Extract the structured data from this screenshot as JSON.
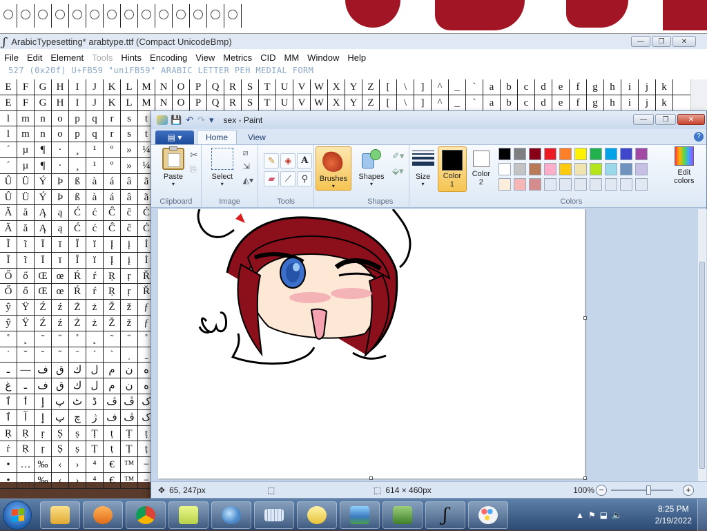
{
  "fontforge": {
    "title": "ArabicTypesetting*  arabtype.ttf (Compact UnicodeBmp)",
    "menu": [
      "File",
      "Edit",
      "Element",
      "Tools",
      "Hints",
      "Encoding",
      "View",
      "Metrics",
      "CID",
      "MM",
      "Window",
      "Help"
    ],
    "info_line": "527 (0x20f) U+FB59 \"uniFB59\" ARABIC LETTER PEH MEDIAL FORM",
    "glyph_rows": [
      [
        "E",
        "F",
        "G",
        "H",
        "I",
        "J",
        "K",
        "L",
        "M",
        "N",
        "O",
        "P",
        "Q",
        "R",
        "S",
        "T",
        "U",
        "V",
        "W",
        "X",
        "Y",
        "Z",
        "[",
        "\\",
        "]",
        "^",
        "_",
        "`",
        "a",
        "b",
        "c",
        "d",
        "e",
        "f",
        "g",
        "h",
        "i",
        "j",
        "k"
      ],
      [
        "E",
        "F",
        "G",
        "H",
        "I",
        "J",
        "K",
        "L",
        "M",
        "N",
        "O",
        "P",
        "Q",
        "R",
        "S",
        "T",
        "U",
        "V",
        "W",
        "X",
        "Y",
        "Z",
        "[",
        "\\",
        "]",
        "^",
        "_",
        "`",
        "a",
        "b",
        "c",
        "d",
        "e",
        "f",
        "g",
        "h",
        "i",
        "j",
        "k"
      ],
      [
        "l",
        "m",
        "n",
        "o",
        "p",
        "q",
        "r",
        "s",
        "t"
      ],
      [
        "l",
        "m",
        "n",
        "o",
        "p",
        "q",
        "r",
        "s",
        "t"
      ],
      [
        "´",
        "µ",
        "¶",
        "·",
        "¸",
        "¹",
        "º",
        "»",
        "¼"
      ],
      [
        "´",
        "µ",
        "¶",
        "·",
        "¸",
        "¹",
        "º",
        "»",
        "¼"
      ],
      [
        "Û",
        "Ü",
        "Ý",
        "Þ",
        "ß",
        "à",
        "á",
        "â",
        "ã"
      ],
      [
        "Û",
        "Ü",
        "Ý",
        "Þ",
        "ß",
        "à",
        "á",
        "â",
        "ã"
      ],
      [
        "Ă",
        "ă",
        "Ą",
        "ą",
        "Ć",
        "ć",
        "Ĉ",
        "ĉ",
        "Ċ"
      ],
      [
        "Ă",
        "ă",
        "Ą",
        "ą",
        "Ć",
        "ć",
        "Ĉ",
        "ĉ",
        "Ċ"
      ],
      [
        "Ĩ",
        "ĩ",
        "Ī",
        "ī",
        "Ĭ",
        "ĭ",
        "Į",
        "į",
        "İ"
      ],
      [
        "Ĩ",
        "ĩ",
        "Ī",
        "ī",
        "Ĭ",
        "ĭ",
        "Į",
        "į",
        "İ"
      ],
      [
        "Ő",
        "ő",
        "Œ",
        "œ",
        "Ŕ",
        "ŕ",
        "Ŗ",
        "ŗ",
        "Ř"
      ],
      [
        "Ő",
        "ő",
        "Œ",
        "œ",
        "Ŕ",
        "ŕ",
        "Ŗ",
        "ŗ",
        "Ř"
      ],
      [
        "ŷ",
        "Ÿ",
        "Ź",
        "ź",
        "Ż",
        "ż",
        "Ž",
        "ž",
        "ƒ"
      ],
      [
        "ŷ",
        "Ÿ",
        "Ź",
        "ź",
        "Ż",
        "ż",
        "Ž",
        "ž",
        "ƒ"
      ],
      [
        "˚",
        "˛",
        "˜",
        "˝",
        "˚",
        "˛",
        "˜",
        "˝",
        "˚"
      ],
      [
        "˙",
        "ˇ",
        "˘",
        "˝",
        "ˉ",
        "ˊ",
        "ˋ",
        "ˌ",
        "ˍ"
      ],
      [
        "ـ",
        "—",
        "ف",
        "ق",
        "ك",
        "ل",
        "م",
        "ن",
        "ه"
      ],
      [
        "غ",
        "ـ",
        "ف",
        "ق",
        "ك",
        "ل",
        "م",
        "ن",
        "ه"
      ],
      [
        "ٱ",
        "ٲ",
        "ٳ",
        "پ",
        "ٹ",
        "ڈ",
        "ڤ",
        "ڦ",
        "ک"
      ],
      [
        "ٱ",
        "آ",
        "ٳ",
        "پ",
        "چ",
        "ژ",
        "ف",
        "ڤ",
        "ک"
      ],
      [
        "Ṛ",
        "Ṛ",
        "ṛ",
        "Ṣ",
        "ṣ",
        "Ṭ",
        "ṭ",
        "Ṭ",
        "ṭ"
      ],
      [
        "ṙ",
        "Ṛ",
        "ṛ",
        "Ṣ",
        "ṣ",
        "Ṭ",
        "ṭ",
        "Ṭ",
        "ṭ"
      ],
      [
        "•",
        "…",
        "‰",
        "‹",
        "›",
        "⁴",
        "€",
        "™",
        "−"
      ],
      [
        "•",
        "…",
        "‰",
        "‹",
        "›",
        "⁴",
        "€",
        "™",
        "−"
      ]
    ]
  },
  "paint": {
    "title": "sex - Paint",
    "file_menu_label": "▤ ▾",
    "tabs": [
      "Home",
      "View"
    ],
    "groups": {
      "clipboard": "Clipboard",
      "image": "Image",
      "tools": "Tools",
      "shapes": "Shapes",
      "colors": "Colors"
    },
    "buttons": {
      "paste": "Paste",
      "select": "Select",
      "brushes": "Brushes",
      "shapes": "Shapes",
      "size": "Size",
      "color1": "Color\n1",
      "color2": "Color\n2",
      "edit_colors": "Edit\ncolors"
    },
    "color1": "#000000",
    "color2": "#ffffff",
    "palette": [
      [
        "#000000",
        "#7f7f7f",
        "#880015",
        "#ed1c24",
        "#ff7f27",
        "#fff200",
        "#22b14c",
        "#00a2e8",
        "#3f48cc",
        "#a349a4"
      ],
      [
        "#ffffff",
        "#c3c3c3",
        "#b97a57",
        "#ffaec9",
        "#ffc90e",
        "#efe4b0",
        "#b5e61d",
        "#99d9ea",
        "#7092be",
        "#c8bfe7"
      ],
      [
        "#fdeedc",
        "#f7b6b6",
        "#d58c8c",
        "#e1e8f2",
        "#e1e8f2",
        "#e1e8f2",
        "#e1e8f2",
        "#e1e8f2",
        "#e1e8f2",
        "#e1e8f2"
      ]
    ],
    "status": {
      "cursor_pos": "65, 247px",
      "selection": "",
      "image_size": "614 × 460px",
      "zoom": "100%"
    }
  },
  "taskbar": {
    "time": "8:25 PM",
    "date": "2/19/2022"
  }
}
